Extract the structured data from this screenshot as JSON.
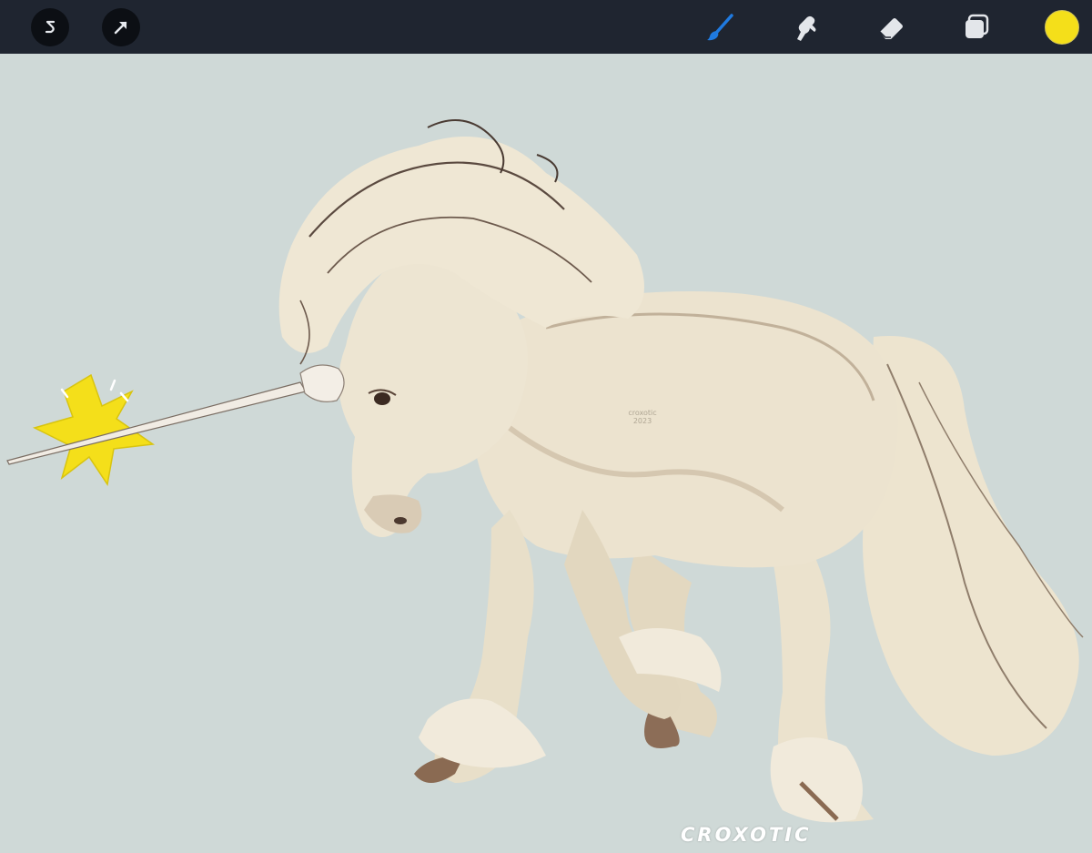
{
  "toolbar": {
    "left_tools": [
      {
        "name": "adjustments",
        "icon": "s-curve-icon"
      },
      {
        "name": "selection",
        "icon": "arrow-cursor-icon"
      }
    ],
    "right_tools": [
      {
        "name": "brush",
        "icon": "brush-icon",
        "active": true
      },
      {
        "name": "smudge",
        "icon": "smudge-finger-icon",
        "active": false
      },
      {
        "name": "eraser",
        "icon": "eraser-icon",
        "active": false
      },
      {
        "name": "layers",
        "icon": "layers-icon",
        "active": false
      }
    ],
    "current_color": "#f4df1a",
    "accent": "#1f7ae0",
    "bar_color": "#1f2530"
  },
  "canvas": {
    "background": "#cfd9d7",
    "artwork": "unicorn with sparkle at horn tip",
    "signature": "CROXOTIC"
  }
}
